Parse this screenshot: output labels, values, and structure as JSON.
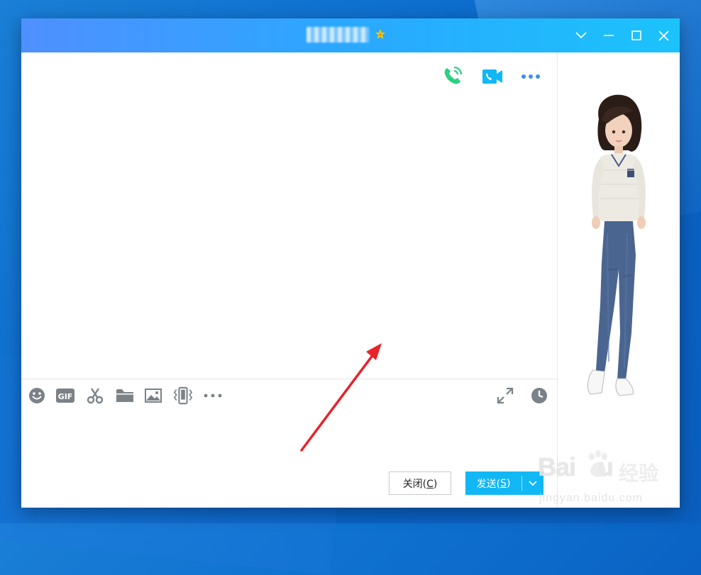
{
  "window": {
    "title": "",
    "controls": [
      "chevron-down-icon",
      "minimize-icon",
      "maximize-icon",
      "close-icon"
    ]
  },
  "chat_header": {
    "actions": [
      "voice-call-icon",
      "video-call-icon",
      "more-icon"
    ]
  },
  "toolbar": {
    "items": [
      "emoji-icon",
      "gif-icon",
      "scissors-icon",
      "folder-icon",
      "image-icon",
      "shake-icon",
      "more-icon",
      "expand-icon",
      "history-clock-icon"
    ],
    "gif_label": "GIF"
  },
  "buttons": {
    "close_prefix": "关闭(",
    "close_key": "C",
    "close_suffix": ")",
    "send_prefix": "发送(",
    "send_key": "S",
    "send_suffix": ")"
  },
  "watermark": {
    "brand": "Bai",
    "brand_tail": "u",
    "cn": "经验",
    "url": "jingyan.baidu.com"
  },
  "colors": {
    "titlebar_start": "#4f90ff",
    "titlebar_end": "#1bc3fb",
    "send_button": "#12b7f5",
    "voice_green": "#2ad181",
    "video_blue": "#12b7f5",
    "icon_gray": "#7b8187",
    "annotation_red": "#e8232a"
  }
}
